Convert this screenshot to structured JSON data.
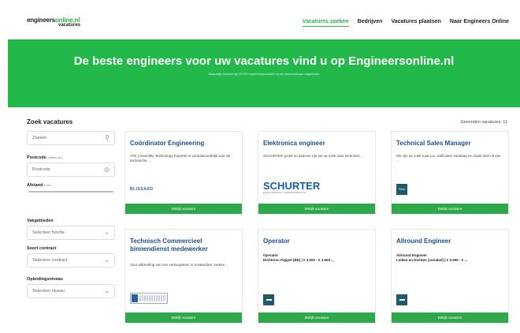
{
  "header": {
    "logo_part1": "engineers",
    "logo_part2": "online.nl",
    "logo_sub": "vacatures",
    "nav": [
      "Vacatures zoeken",
      "Bedrijven",
      "Vacatures plaatsen",
      "Naar Engineers Online"
    ],
    "accent_color": "#2db342"
  },
  "hero": {
    "title": "De beste engineers voor uw vacatures vind u op Engineersonline.nl",
    "subtitle": "Maandelijks bereiken wij 100.000 engineers/specialisten op een breed scala aan vakgebieden"
  },
  "sidebar": {
    "title": "Zoek vacatures",
    "search_placeholder": "Zoeken",
    "postcode_label": "Postcode",
    "postcode_hint": "(alleen NL)",
    "postcode_placeholder": "Postcode",
    "distance_label": "Afstand",
    "distance_hint": "0 km",
    "field_label": "Vakgebieden",
    "field_select": "Selecteer functie",
    "contract_label": "Soort contract",
    "contract_select": "Selecteer contract",
    "education_label": "Opleidingsniveau",
    "education_select": "Selecteer niveau"
  },
  "results": {
    "count_text": "Gevonden vacatures: 11"
  },
  "cards": [
    {
      "title": "Coördinator Engineering",
      "desc": "ATE (Assembly Technology Experts) is verantwoordelijk voor de technische ...",
      "logo": "BLISSARD",
      "button": "Bekijk vacature"
    },
    {
      "title": "Elektronica engineer",
      "desc": "SCHURTER groeit en daarom zijn we op zoek naar technisch ...",
      "logo": "SCHURTER",
      "logo_sub": "ELECTRONIC COMPONENTS",
      "button": "Bekijk vacature"
    },
    {
      "title": "Technical Sales Manager",
      "desc": "We zijn op zoek naar jou. Solliciteer vandaag en maak deel uit van ...",
      "logo": "Fleet",
      "button": "Bekijk vacature"
    },
    {
      "title": "Technisch Commercieel binnendienst medewerker",
      "desc": "Voor uitbreiding van ons verkoopteam in Amsterdam zoeken ...",
      "logo": "",
      "button": "Bekijk vacature"
    },
    {
      "title": "Operator",
      "desc_bold": "Operator",
      "desc": "Dichteren Pappel (BE) | € 3.000 - € 3.500 ...",
      "logo": "",
      "button": "Bekijk vacature"
    },
    {
      "title": "Allround Engineer",
      "desc_bold": "Allround Engineer",
      "desc": "Leiden en Dichten (variabel) | € 3.000 - € ...",
      "logo": "",
      "button": "Bekijk vacature"
    }
  ]
}
